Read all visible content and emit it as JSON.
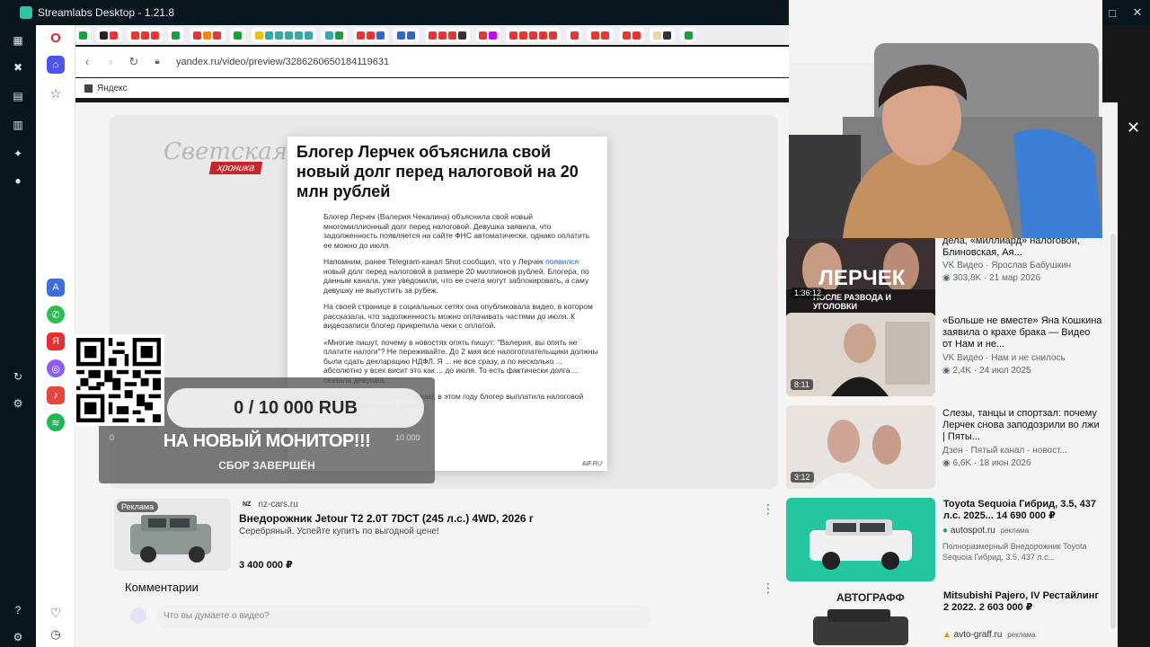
{
  "app": {
    "title": "Streamlabs Desktop - 1.21.8"
  },
  "browser": {
    "url": "yandex.ru/video/preview/3286260650184119631",
    "bookmark": "Яндекс"
  },
  "video": {
    "brand_line1": "Светская",
    "brand_line2": "хроника",
    "article_title": "Блогер Лерчек объяснила свой новый долг перед налоговой на 20 млн рублей",
    "paragraphs": [
      "Блогер Лерчек (Валерия Чекалина) объяснила свой новый многомиллионный долг перед налоговой. Девушка заявила, что задолженность появляется на сайте ФНС автоматически, однако оплатить ее можно до июля.",
      "Напомним, ранее Telegram-канал Shot сообщил, что у Лерчек",
      "появился",
      "новый долг перед налоговой в размере 20 миллионов рублей. Блогера, по данным канала, уже уведомили, что ее счета могут заблокировать, а саму девушку не выпустить за рубеж.",
      "На своей странице в социальных сетях она опубликовала видео, в котором рассказала, что задолженность можно оплачивать частями до июля. К видеозаписи блогер прикрепила чеки с оплатой.",
      "«Многие пишут, почему в новостях опять пишут: \"Валерия, вы опять не платите налоги\"? Не переживайте. До 2 мая все налогоплательщики должны были сдать декларацию НДФЛ. Я ... не все сразу, а по несколько ... абсолютно у всех висит это как ... до июля. То есть фактически долга ... сказала девушка.",
      "Судя по прикрепленным чекам, в этом году блогер выплатила налоговой более 28 миллионов рублей."
    ],
    "source": "AIF.RU"
  },
  "donation": {
    "progress": "0 / 10 000 RUB",
    "min": "0",
    "max": "10 000",
    "goal": "НА НОВЫЙ МОНИТОР!!!",
    "status": "СБОР ЗАВЕРШЁН"
  },
  "ad": {
    "badge": "Реклама",
    "domain_logo": "NZ",
    "domain": "nz-cars.ru",
    "title": "Внедорожник Jetour T2 2.0T 7DCT (245 л.с.) 4WD, 2026 г",
    "desc": "Серебряный. Успейте купить по выгодной цене!",
    "price": "3 400 000 ₽"
  },
  "comments": {
    "heading": "Комментарии",
    "placeholder": "Что вы думаете о видео?"
  },
  "recommendations": [
    {
      "thumb_text": "ЛЕРЧЕК",
      "thumb_sub": "ПОСЛЕ РАЗВОДА И УГОЛОВКИ",
      "duration": "1:36:12",
      "title": "дела, «миллиард» налоговой, Блиновская, Ая...",
      "channel": "VK Видео · Ярослав Бабушкин",
      "meta": "303,8K · 21 мар 2026"
    },
    {
      "duration": "8:11",
      "title": "«Больше не вместе» Яна Кошкина заявила о крахе брака — Видео от Нам и не...",
      "channel": "VK Видео · Нам и не снилось",
      "meta": "2,4K · 24 июл 2025"
    },
    {
      "duration": "3:12",
      "title": "Слезы, танцы и спортзал: почему Лерчек снова заподозрили во лжи | Пяты...",
      "channel": "Дзен · Пятый канал - новост...",
      "meta": "6,6K · 18 июн 2026"
    }
  ],
  "ads_right": [
    {
      "title": "Toyota Sequoia Гибрид, 3.5, 437 л.с. 2025... 14 690 000 ₽",
      "domain": "autospot.ru",
      "label": "реклама",
      "desc": "Полноразмерный Внедорожник Toyota Sequoia Гибрид, 3.5, 437 л.с..."
    },
    {
      "thumb_text": "АВТОГРАФФ",
      "title": "Mitsubishi Pajero, IV Рестайлинг 2 2022. 2 603 000 ₽",
      "domain": "avto-graff.ru",
      "label": "реклама"
    }
  ],
  "colors": {
    "accent": "#4b53f0",
    "ad_green": "#22c7a0",
    "streamlabs": "#09161d"
  }
}
